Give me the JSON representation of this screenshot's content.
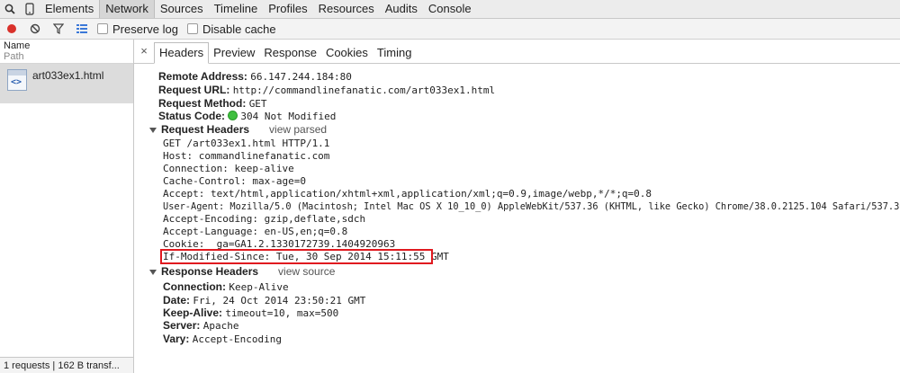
{
  "topbar": {
    "tabs": [
      "Elements",
      "Network",
      "Sources",
      "Timeline",
      "Profiles",
      "Resources",
      "Audits",
      "Console"
    ],
    "active": "Network"
  },
  "toolbar": {
    "preserve_log": "Preserve log",
    "disable_cache": "Disable cache",
    "record_color": "#d9312b"
  },
  "left": {
    "name_header": "Name",
    "path_header": "Path",
    "request_name": "art033ex1.html",
    "footer": "1 requests | 162 B transf..."
  },
  "detail": {
    "close": "×",
    "tabs": [
      "Headers",
      "Preview",
      "Response",
      "Cookies",
      "Timing"
    ],
    "active": "Headers"
  },
  "general": {
    "remote_address_k": "Remote Address:",
    "remote_address_v": "66.147.244.184:80",
    "request_url_k": "Request URL:",
    "request_url_v": "http://commandlinefanatic.com/art033ex1.html",
    "request_method_k": "Request Method:",
    "request_method_v": "GET",
    "status_code_k": "Status Code:",
    "status_code_v": "304 Not Modified"
  },
  "request_headers": {
    "title": "Request Headers",
    "link": "view parsed",
    "lines": [
      "GET /art033ex1.html HTTP/1.1",
      "Host: commandlinefanatic.com",
      "Connection: keep-alive",
      "Cache-Control: max-age=0",
      "Accept: text/html,application/xhtml+xml,application/xml;q=0.9,image/webp,*/*;q=0.8",
      "User-Agent: Mozilla/5.0 (Macintosh; Intel Mac OS X 10_10_0) AppleWebKit/537.36 (KHTML, like Gecko) Chrome/38.0.2125.104 Safari/537.36",
      "Accept-Encoding: gzip,deflate,sdch",
      "Accept-Language: en-US,en;q=0.8",
      "Cookie: _ga=GA1.2.1330172739.1404920963",
      "If-Modified-Since: Tue, 30 Sep 2014 15:11:55 GMT"
    ]
  },
  "response_headers": {
    "title": "Response Headers",
    "link": "view source",
    "items": [
      {
        "k": "Connection:",
        "v": "Keep-Alive"
      },
      {
        "k": "Date:",
        "v": "Fri, 24 Oct 2014 23:50:21 GMT"
      },
      {
        "k": "Keep-Alive:",
        "v": "timeout=10, max=500"
      },
      {
        "k": "Server:",
        "v": "Apache"
      },
      {
        "k": "Vary:",
        "v": "Accept-Encoding"
      }
    ]
  },
  "highlight_color": "#e0191f"
}
